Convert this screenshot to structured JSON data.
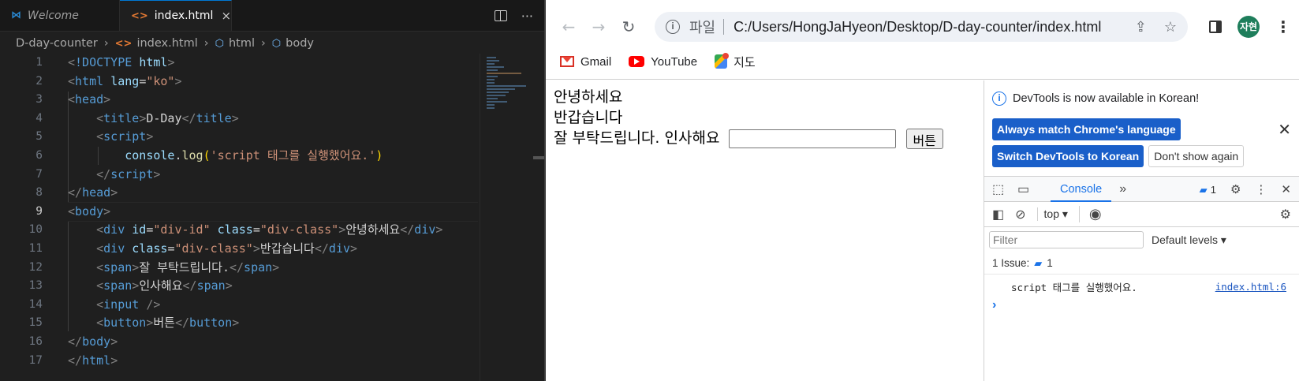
{
  "vscode": {
    "tabs": [
      {
        "label": "Welcome"
      },
      {
        "label": "index.html",
        "close": "×"
      }
    ],
    "actions_more": "···",
    "breadcrumb": [
      "D-day-counter",
      "index.html",
      "html",
      "body"
    ],
    "line_numbers": [
      "1",
      "2",
      "3",
      "4",
      "5",
      "6",
      "7",
      "8",
      "9",
      "10",
      "11",
      "12",
      "13",
      "14",
      "15",
      "16",
      "17"
    ]
  },
  "chrome": {
    "omnibox": {
      "label": "파일",
      "url": "C:/Users/HongJaHyeon/Desktop/D-day-counter/index.html"
    },
    "avatar_text": "자현",
    "bookmarks": [
      {
        "label": "Gmail"
      },
      {
        "label": "YouTube"
      },
      {
        "label": "지도"
      }
    ],
    "page": {
      "line1": "안녕하세요",
      "line2": "반갑습니다",
      "span1": "잘 부탁드립니다.",
      "span2": "인사해요",
      "button": "버튼"
    }
  },
  "devtools": {
    "banner_message": "DevTools is now available in Korean!",
    "btn_match": "Always match Chrome's language",
    "btn_switch": "Switch DevTools to Korean",
    "btn_dont": "Don't show again",
    "tab_console": "Console",
    "message_count": "1",
    "context": "top",
    "filter_placeholder": "Filter",
    "levels": "Default levels",
    "issues_label": "1 Issue:",
    "issues_count": "1",
    "log_text": "script 태그를 실행했어요.",
    "log_source": "index.html:6",
    "colors": {
      "accent": "#1a73e8",
      "button_blue": "#1a5fc9",
      "vscode_bg": "#1f1f1f"
    },
    "icons": [
      "inspect-icon",
      "device-toolbar-icon",
      "more-tabs-icon",
      "settings-icon",
      "kebab-icon",
      "close-icon",
      "sidebar-icon",
      "clear-icon",
      "eye-icon",
      "gear-icon"
    ]
  }
}
